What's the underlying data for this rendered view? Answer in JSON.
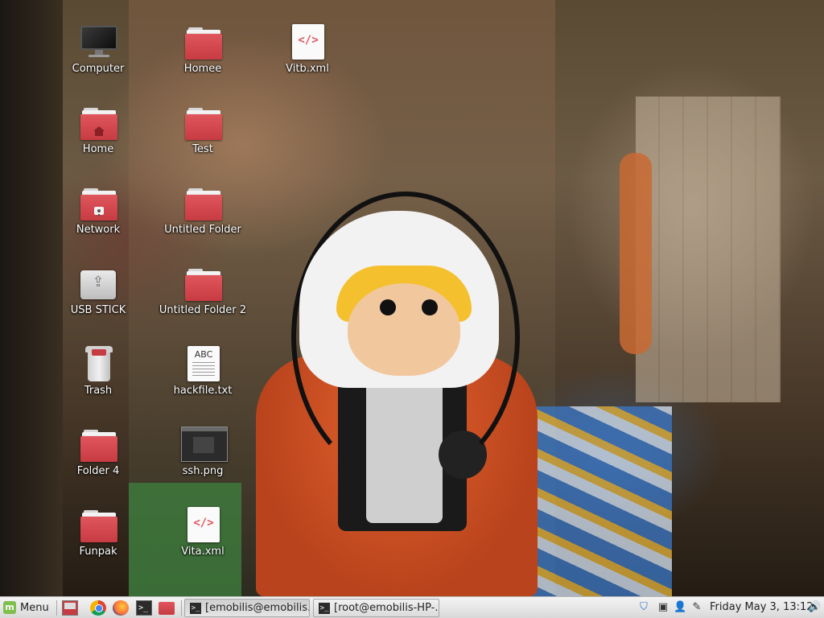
{
  "desktop": {
    "icons": [
      {
        "label": "Computer",
        "icon": "computer-icon"
      },
      {
        "label": "Home",
        "icon": "home-folder-icon"
      },
      {
        "label": "Network",
        "icon": "network-folder-icon"
      },
      {
        "label": "USB STICK",
        "icon": "usb-drive-icon"
      },
      {
        "label": "Trash",
        "icon": "trash-icon"
      },
      {
        "label": "Folder 4",
        "icon": "folder-icon"
      },
      {
        "label": "Funpak",
        "icon": "folder-icon"
      },
      {
        "label": "Homee",
        "icon": "folder-icon"
      },
      {
        "label": "Test",
        "icon": "folder-icon"
      },
      {
        "label": "Untitled Folder",
        "icon": "folder-icon"
      },
      {
        "label": "Untitled Folder 2",
        "icon": "folder-icon"
      },
      {
        "label": "hackfile.txt",
        "icon": "text-file-icon",
        "preview_text": "ABC"
      },
      {
        "label": "ssh.png",
        "icon": "image-file-icon"
      },
      {
        "label": "Vita.xml",
        "icon": "xml-file-icon",
        "preview_text": "</>"
      },
      {
        "label": "Vitb.xml",
        "icon": "xml-file-icon",
        "preview_text": "</>"
      }
    ]
  },
  "taskbar": {
    "menu_label": "Menu",
    "menu_logo_text": "m",
    "quick_launch": [
      "show-desktop-icon",
      "chrome-icon",
      "firefox-icon",
      "terminal-icon",
      "files-icon"
    ],
    "terminal_glyph": ">_",
    "windows": [
      {
        "title": "[emobilis@emobilis...",
        "active": true
      },
      {
        "title": "[root@emobilis-HP-...",
        "active": false
      }
    ],
    "tray": {
      "shield_glyph": "⛉",
      "clipboard_glyph": "▣",
      "user_glyph": "👤",
      "network_glyph": "✎",
      "volume_glyph": "🔊"
    },
    "clock": "Friday May  3, 13:12"
  },
  "colors": {
    "folder_red": "#c73b42",
    "taskbar_bg": "#e6e6e6",
    "mint_green": "#7fbf4d"
  }
}
